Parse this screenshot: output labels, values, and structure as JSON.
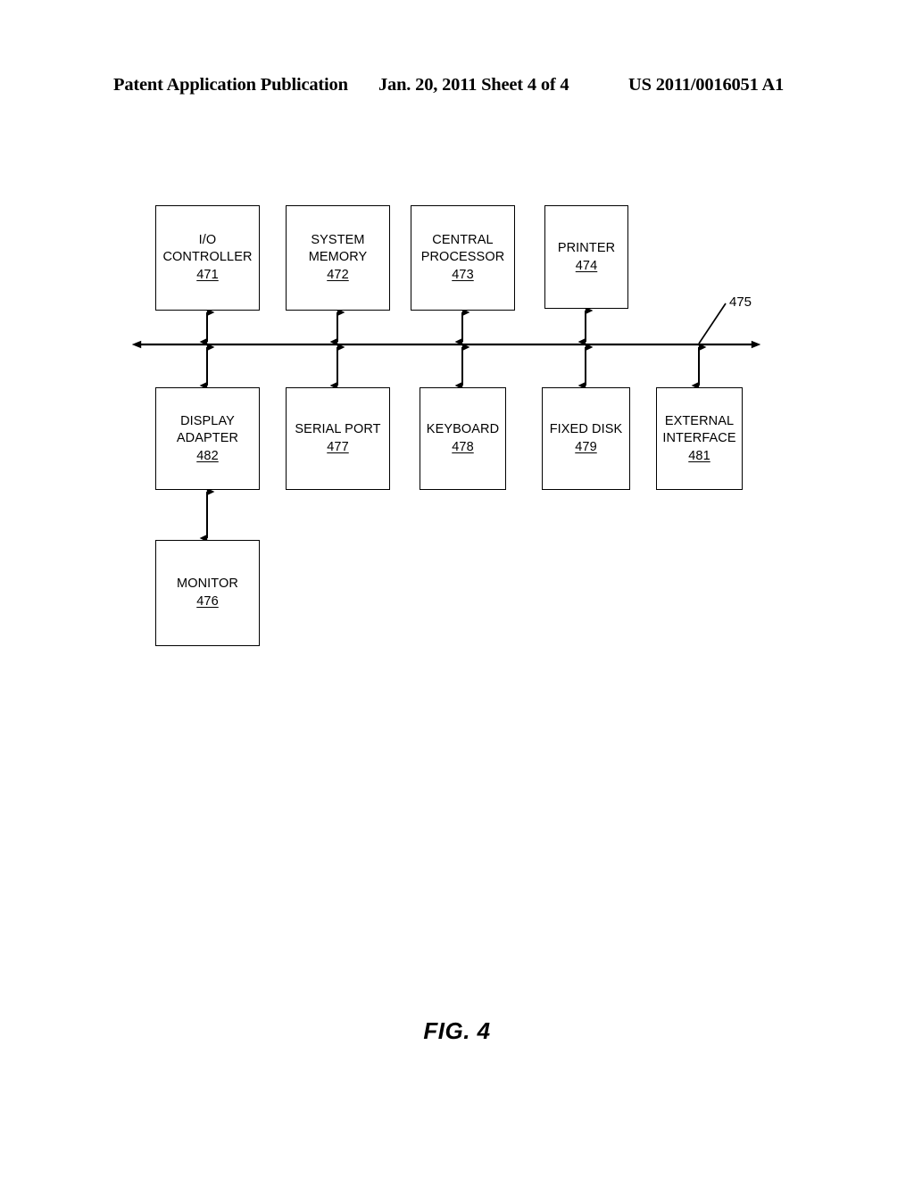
{
  "header": {
    "left": "Patent Application Publication",
    "middle": "Jan. 20, 2011  Sheet 4 of 4",
    "right": "US 2011/0016051 A1"
  },
  "figure": {
    "caption": "FIG. 4",
    "bus": {
      "ref": "475",
      "name": "system-bus"
    },
    "top_row": [
      {
        "label": "I/O\nCONTROLLER",
        "ref": "471",
        "name": "io-controller"
      },
      {
        "label": "SYSTEM\nMEMORY",
        "ref": "472",
        "name": "system-memory"
      },
      {
        "label": "CENTRAL\nPROCESSOR",
        "ref": "473",
        "name": "central-processor"
      },
      {
        "label": "PRINTER",
        "ref": "474",
        "name": "printer"
      }
    ],
    "bottom_row": [
      {
        "label": "DISPLAY\nADAPTER",
        "ref": "482",
        "name": "display-adapter"
      },
      {
        "label": "SERIAL PORT",
        "ref": "477",
        "name": "serial-port"
      },
      {
        "label": "KEYBOARD",
        "ref": "478",
        "name": "keyboard"
      },
      {
        "label": "FIXED DISK",
        "ref": "479",
        "name": "fixed-disk"
      },
      {
        "label": "EXTERNAL\nINTERFACE",
        "ref": "481",
        "name": "external-interface"
      }
    ],
    "peripherals": [
      {
        "label": "MONITOR",
        "ref": "476",
        "name": "monitor"
      }
    ]
  },
  "colors": {
    "ink": "#000000",
    "paper": "#ffffff"
  }
}
